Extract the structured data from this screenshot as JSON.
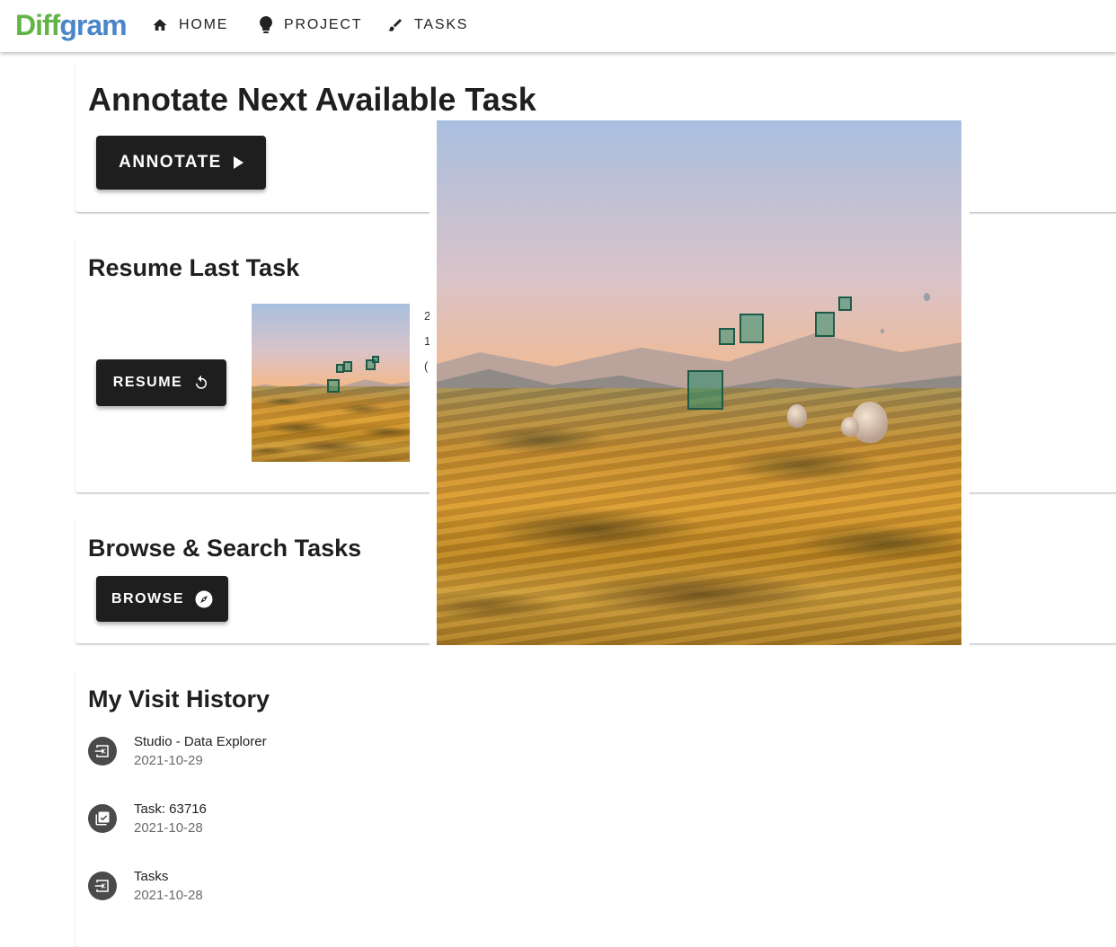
{
  "app": {
    "logo_part1": "Diff",
    "logo_part2": "gram"
  },
  "nav": [
    {
      "label": "HOME",
      "icon": "home-icon"
    },
    {
      "label": "PROJECT",
      "icon": "lightbulb-icon"
    },
    {
      "label": "TASKS",
      "icon": "brush-icon"
    }
  ],
  "annotate_card": {
    "title": "Annotate Next Available Task",
    "button_label": "ANNOTATE",
    "button_icon": "play-arrow-icon"
  },
  "resume_card": {
    "title": "Resume Last Task",
    "button_label": "RESUME",
    "button_icon": "restore-icon",
    "partial_text": [
      "2",
      "1",
      "("
    ]
  },
  "browse_card": {
    "title": "Browse & Search Tasks",
    "button_label": "BROWSE",
    "button_icon": "compass-icon"
  },
  "history_card": {
    "title": "My Visit History",
    "items": [
      {
        "title": "Studio - Data Explorer",
        "date": "2021-10-29",
        "icon": "input-icon"
      },
      {
        "title": "Task: 63716",
        "date": "2021-10-28",
        "icon": "library-add-check-icon"
      },
      {
        "title": "Tasks",
        "date": "2021-10-28",
        "icon": "input-icon"
      }
    ]
  },
  "colors": {
    "logo_green": "#62b446",
    "logo_blue": "#4a86c8",
    "button_bg": "#1e1e1e",
    "bbox": "#1e5a48"
  }
}
